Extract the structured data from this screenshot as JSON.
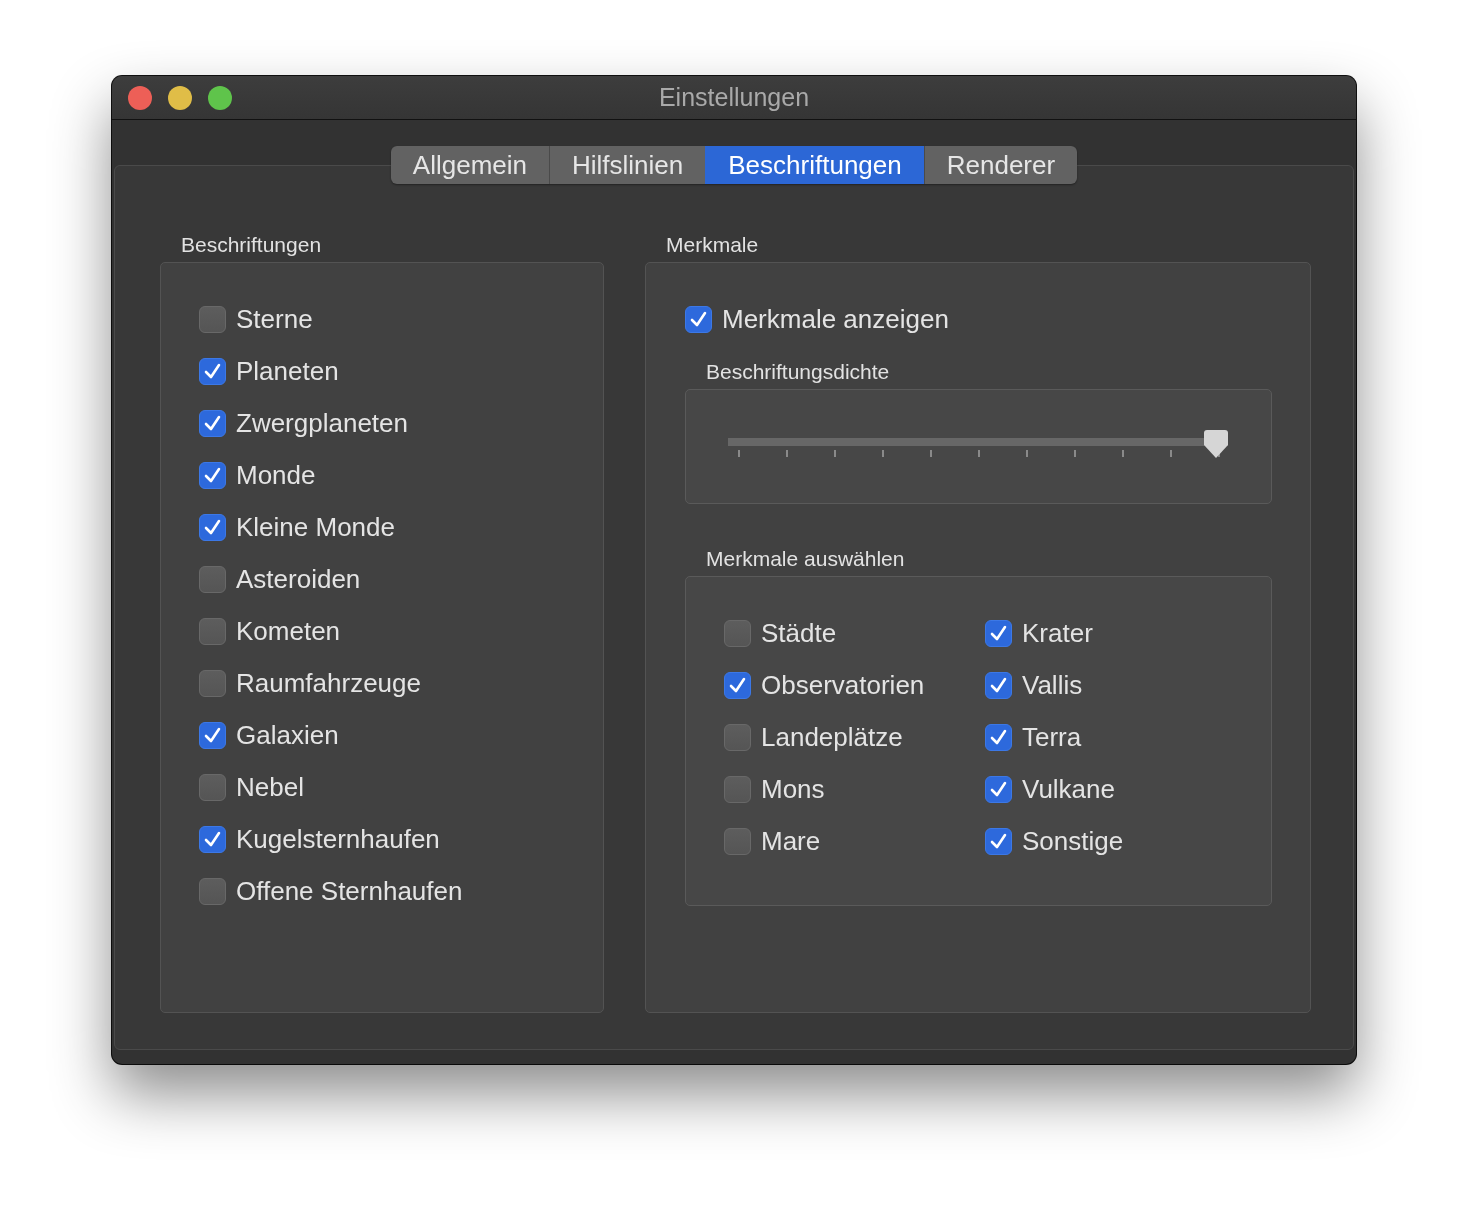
{
  "window": {
    "title": "Einstellungen"
  },
  "tabs": [
    {
      "label": "Allgemein",
      "selected": false
    },
    {
      "label": "Hilfslinien",
      "selected": false
    },
    {
      "label": "Beschriftungen",
      "selected": true
    },
    {
      "label": "Renderer",
      "selected": false
    }
  ],
  "labels_group": {
    "title": "Beschriftungen",
    "items": [
      {
        "label": "Sterne",
        "checked": false
      },
      {
        "label": "Planeten",
        "checked": true
      },
      {
        "label": "Zwergplaneten",
        "checked": true
      },
      {
        "label": "Monde",
        "checked": true
      },
      {
        "label": "Kleine Monde",
        "checked": true
      },
      {
        "label": "Asteroiden",
        "checked": false
      },
      {
        "label": "Kometen",
        "checked": false
      },
      {
        "label": "Raumfahrzeuge",
        "checked": false
      },
      {
        "label": "Galaxien",
        "checked": true
      },
      {
        "label": "Nebel",
        "checked": false
      },
      {
        "label": "Kugelsternhaufen",
        "checked": true
      },
      {
        "label": "Offene Sternhaufen",
        "checked": false
      }
    ]
  },
  "features_group": {
    "title": "Merkmale",
    "show_features": {
      "label": "Merkmale anzeigen",
      "checked": true
    },
    "density": {
      "title": "Beschriftungsdichte",
      "level": 1
    },
    "selection": {
      "title": "Merkmale auswählen",
      "items": [
        {
          "label": "Städte",
          "checked": false
        },
        {
          "label": "Krater",
          "checked": true
        },
        {
          "label": "Observatorien",
          "checked": true
        },
        {
          "label": "Vallis",
          "checked": true
        },
        {
          "label": "Landeplätze",
          "checked": false
        },
        {
          "label": "Terra",
          "checked": true
        },
        {
          "label": "Mons",
          "checked": false
        },
        {
          "label": "Vulkane",
          "checked": true
        },
        {
          "label": "Mare",
          "checked": false
        },
        {
          "label": "Sonstige",
          "checked": true
        }
      ]
    }
  }
}
